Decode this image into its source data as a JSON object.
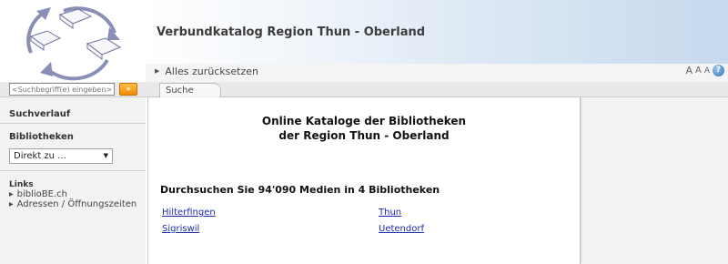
{
  "header": {
    "site_title": "Verbundkatalog Region Thun - Oberland",
    "logo_icon": "book-cycle-logo"
  },
  "toolbar": {
    "reset_label": "Alles zurücksetzen",
    "font_small": "A",
    "font_medium": "A",
    "font_large": "A",
    "help_glyph": "?"
  },
  "search": {
    "placeholder": "<Suchbegriff(e) eingeben>",
    "go_label": "»"
  },
  "tabs": [
    {
      "label": "Suche"
    }
  ],
  "sidebar": {
    "history_heading": "Suchverlauf",
    "libraries_heading": "Bibliotheken",
    "library_select": "Direkt zu ...",
    "links_heading": "Links",
    "links": [
      {
        "label": "biblioBE.ch"
      },
      {
        "label": "Adressen / Öffnungszeiten"
      }
    ]
  },
  "main": {
    "title_line1": "Online Kataloge der Bibliotheken",
    "title_line2": "der Region Thun - Oberland",
    "subtitle": "Durchsuchen Sie 94'090 Medien in 4 Bibliotheken",
    "libraries": [
      {
        "name": "Hilterfingen"
      },
      {
        "name": "Thun"
      },
      {
        "name": "Sigriswil"
      },
      {
        "name": "Uetendorf"
      }
    ]
  },
  "colors": {
    "accent_orange": "#f08a00",
    "link_blue": "#1b2bb0",
    "header_gradient_end": "#c7d9ee"
  }
}
